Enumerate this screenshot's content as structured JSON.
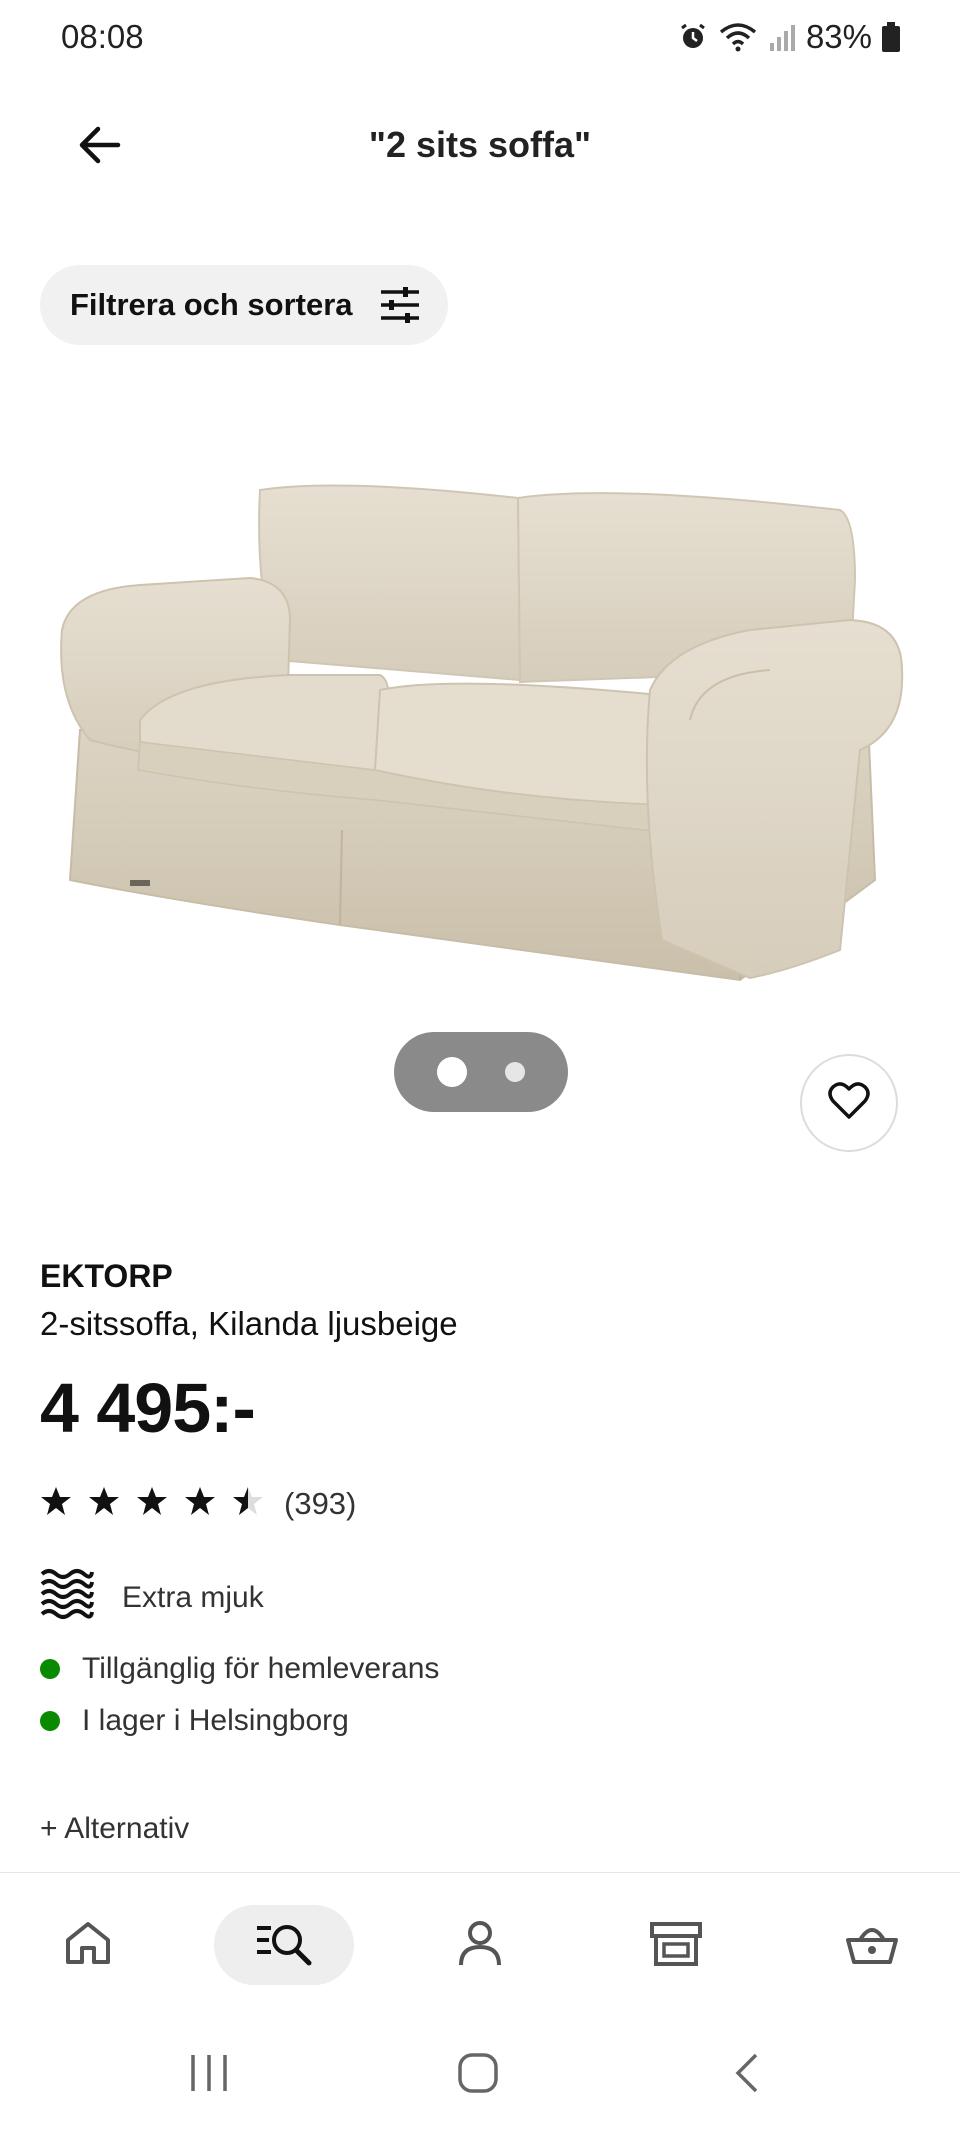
{
  "status_bar": {
    "time": "08:08",
    "battery": "83%",
    "icons": [
      "alarm-icon",
      "wifi-icon",
      "signal-icon",
      "battery-icon"
    ]
  },
  "header": {
    "title": "\"2 sits soffa\"",
    "back_icon": "arrow-left-icon"
  },
  "filter": {
    "label": "Filtrera och sortera",
    "icon": "sliders-icon"
  },
  "product": {
    "image": "beige-two-seat-sofa",
    "carousel_count": 2,
    "carousel_active": 0,
    "brand": "EKTORP",
    "description": "2-sitssoffa, Kilanda ljusbeige",
    "price": "4 495:-",
    "rating": 4.5,
    "rating_max": 5,
    "review_count": "(393)",
    "feature": {
      "icon": "softness-waves-icon",
      "label": "Extra mjuk"
    },
    "availability": [
      {
        "text": "Tillgänglig för hemleverans",
        "color": "#0a8a00"
      },
      {
        "text": "I lager i Helsingborg",
        "color": "#0a8a00"
      }
    ],
    "alternatives_label": "+ Alternativ"
  },
  "bottom_nav": {
    "items": [
      {
        "icon": "home-icon",
        "active": false
      },
      {
        "icon": "search-list-icon",
        "active": true
      },
      {
        "icon": "profile-icon",
        "active": false
      },
      {
        "icon": "store-icon",
        "active": false
      },
      {
        "icon": "basket-icon",
        "active": false
      }
    ]
  },
  "system_nav": {
    "items": [
      "recent-apps-icon",
      "home-circle-icon",
      "back-chevron-icon"
    ]
  }
}
